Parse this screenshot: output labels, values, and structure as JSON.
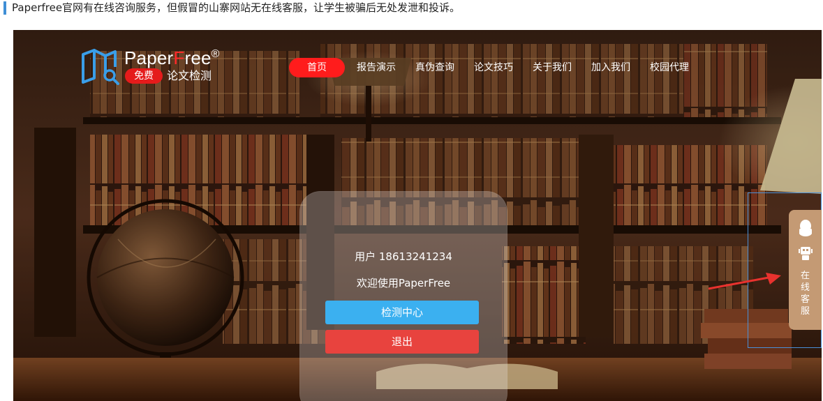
{
  "caption": {
    "text": "Paperfree官网有在线咨询服务，但假冒的山寨网站无在线客服，让学生被骗后无处发泄和投诉。"
  },
  "logo": {
    "brand_prefix": "Paper",
    "brand_f": "F",
    "brand_suffix": "ree",
    "registered": "®",
    "badge": "免费",
    "subtitle": "论文检测"
  },
  "nav": {
    "items": [
      "首页",
      "报告演示",
      "真伪查询",
      "论文技巧",
      "关于我们",
      "加入我们",
      "校园代理"
    ],
    "active_index": 0
  },
  "panel": {
    "user_text": "用户 18613241234",
    "welcome": "欢迎使用PaperFree",
    "check_button": "检测中心",
    "exit_button": "退出"
  },
  "service": {
    "chars": [
      "在",
      "线",
      "客",
      "服"
    ],
    "icons": [
      "qq-icon",
      "robot-icon"
    ]
  },
  "colors": {
    "accent_red": "#ff1c1c",
    "button_blue": "#3bb0f0",
    "button_red": "#e8433e",
    "service_bg": "#c49a74",
    "caption_bar": "#3f8fd6"
  }
}
